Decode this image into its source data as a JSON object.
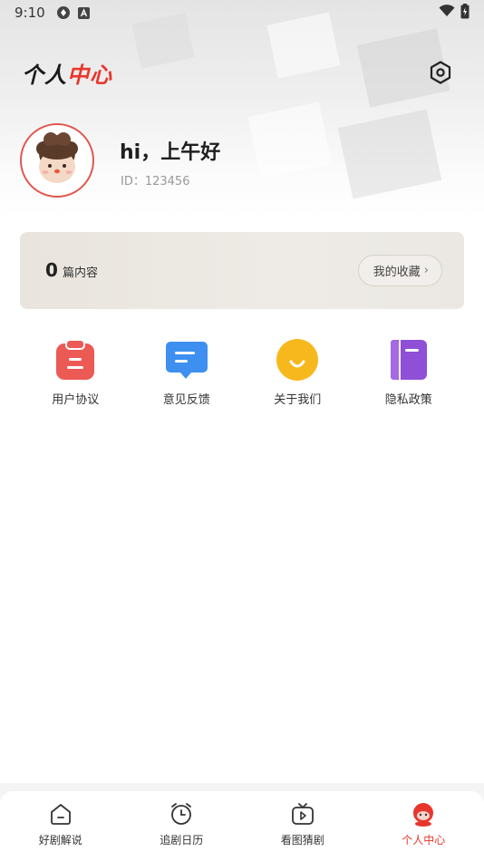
{
  "status_bar": {
    "time": "9:10"
  },
  "header": {
    "title_part1": "个人",
    "title_part2": "中心"
  },
  "profile": {
    "greeting": "hi，上午好",
    "user_id": "ID：123456"
  },
  "stats": {
    "count": "0",
    "count_label": "篇内容",
    "favorites_label": "我的收藏"
  },
  "quick_links": [
    {
      "label": "用户协议",
      "icon": "clipboard-icon",
      "color": "#ec5a55"
    },
    {
      "label": "意见反馈",
      "icon": "chat-bubble-icon",
      "color": "#3d8ff0"
    },
    {
      "label": "关于我们",
      "icon": "smile-icon",
      "color": "#f7b81e"
    },
    {
      "label": "隐私政策",
      "icon": "notebook-icon",
      "color": "#8f4fd6"
    }
  ],
  "tabbar": {
    "tabs": [
      {
        "label": "好剧解说",
        "icon": "home-icon",
        "active": false
      },
      {
        "label": "追剧日历",
        "icon": "alarm-clock-icon",
        "active": false
      },
      {
        "label": "看图猜剧",
        "icon": "tv-play-icon",
        "active": false
      },
      {
        "label": "个人中心",
        "icon": "mascot-icon",
        "active": true
      }
    ]
  },
  "colors": {
    "accent": "#e8362c",
    "card_bg": "#ebe7e1"
  }
}
